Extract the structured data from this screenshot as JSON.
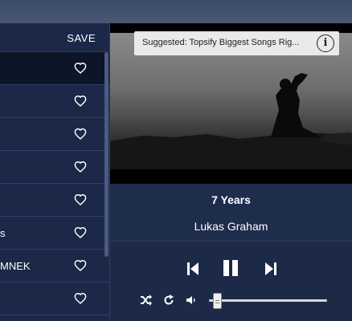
{
  "playlist": {
    "save_label": "SAVE",
    "items": [
      {
        "label": ""
      },
      {
        "label": ""
      },
      {
        "label": ""
      },
      {
        "label": ""
      },
      {
        "label": ""
      },
      {
        "label": "s"
      },
      {
        "label": "MNEK"
      },
      {
        "label": ""
      }
    ]
  },
  "player": {
    "suggestion": "Suggested: Topsify Biggest Songs Rig...",
    "info_glyph": "i",
    "track_title": "7 Years",
    "artist": "Lukas Graham",
    "volume_level": 0.07
  },
  "colors": {
    "background": "#1c2a48",
    "active_row": "#0d1628",
    "text": "#ffffff"
  },
  "icons": [
    "heart-icon",
    "info-icon",
    "skip-previous-icon",
    "pause-icon",
    "skip-next-icon",
    "shuffle-icon",
    "repeat-icon",
    "volume-icon"
  ]
}
